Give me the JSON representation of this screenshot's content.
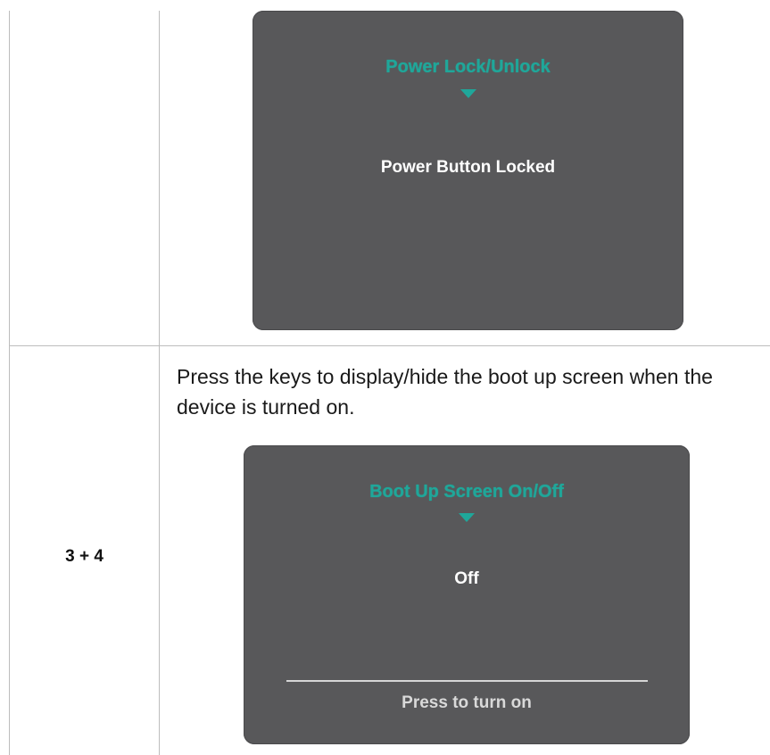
{
  "row_top": {
    "osd": {
      "title": "Power Lock/Unlock",
      "value": "Power Button Locked",
      "arrow_icon": "triangle-down-icon"
    }
  },
  "row_bottom": {
    "key_combo": "3 + 4",
    "description": "Press the keys to display/hide the boot up screen when the device is turned on.",
    "osd": {
      "title": "Boot Up Screen On/Off",
      "value": "Off",
      "hint": "Press to turn on",
      "arrow_icon": "triangle-down-icon"
    }
  },
  "colors": {
    "osd_background": "#58585a",
    "osd_accent": "#1fa79a",
    "table_border": "#bdbdbd"
  }
}
